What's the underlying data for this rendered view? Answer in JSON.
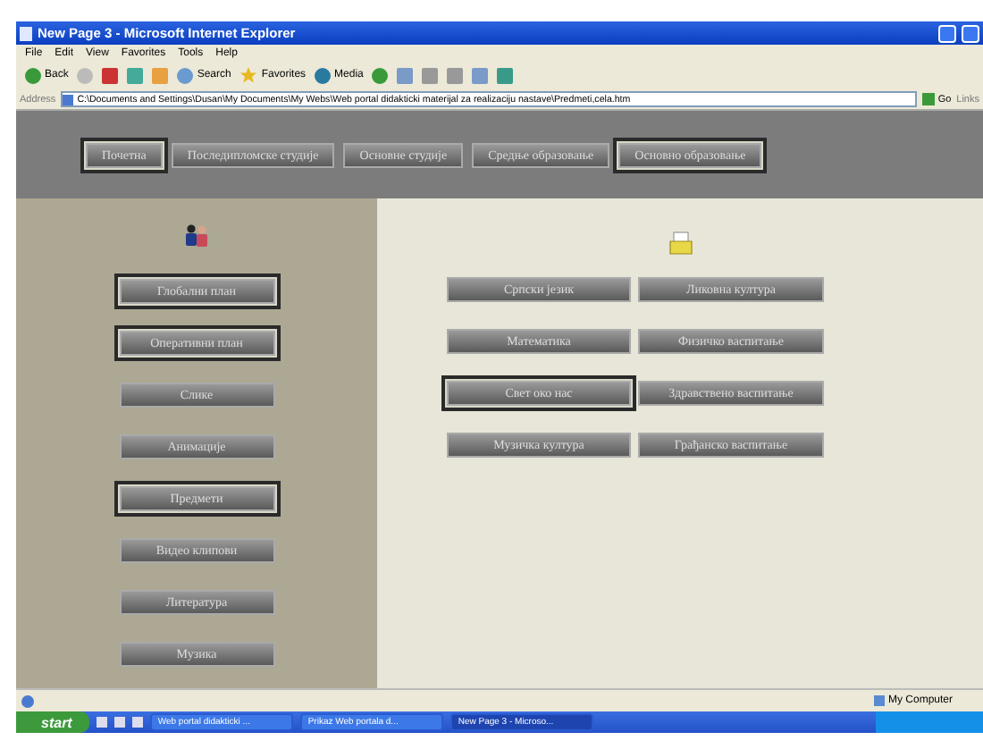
{
  "window": {
    "title": "New Page 3 - Microsoft Internet Explorer"
  },
  "menu": [
    "File",
    "Edit",
    "View",
    "Favorites",
    "Tools",
    "Help"
  ],
  "toolbar": {
    "back": "Back",
    "search": "Search",
    "favorites": "Favorites",
    "media": "Media"
  },
  "address_bar": {
    "label": "Address",
    "value": "C:\\Documents and Settings\\Dusan\\My Documents\\My Webs\\Web portal didakticki materijal za realizaciju nastave\\Predmeti,cela.htm",
    "go": "Go",
    "links": "Links"
  },
  "top_nav": [
    {
      "label": "Почетна",
      "selected": true
    },
    {
      "label": "Последипломске студије",
      "selected": false
    },
    {
      "label": "Основне студије",
      "selected": false
    },
    {
      "label": "Средње образовање",
      "selected": false
    },
    {
      "label": "Основно образовање",
      "selected": true
    }
  ],
  "side_nav": [
    {
      "label": "Глобални план",
      "selected": true
    },
    {
      "label": "Оперативни план",
      "selected": true
    },
    {
      "label": "Слике",
      "selected": false
    },
    {
      "label": "Анимације",
      "selected": false
    },
    {
      "label": "Предмети",
      "selected": true
    },
    {
      "label": "Видео клипови",
      "selected": false
    },
    {
      "label": "Литература",
      "selected": false
    },
    {
      "label": "Музика",
      "selected": false
    }
  ],
  "subjects": [
    {
      "label": "Српски језик",
      "selected": false
    },
    {
      "label": "Ликовна култура",
      "selected": false
    },
    {
      "label": "Математика",
      "selected": false
    },
    {
      "label": "Физичко васпитање",
      "selected": false
    },
    {
      "label": "Свет око нас",
      "selected": true
    },
    {
      "label": "Здравствено васпитање",
      "selected": false
    },
    {
      "label": "Музичка култура",
      "selected": false
    },
    {
      "label": "Грађанско васпитање",
      "selected": false
    }
  ],
  "status_bar": {
    "zone": "My Computer"
  },
  "taskbar": {
    "start": "start",
    "tasks": [
      {
        "label": "Web portal didakticki ...",
        "selected": false
      },
      {
        "label": "Prikaz Web portala d...",
        "selected": false
      },
      {
        "label": "New Page 3 - Microso...",
        "selected": true
      }
    ]
  }
}
